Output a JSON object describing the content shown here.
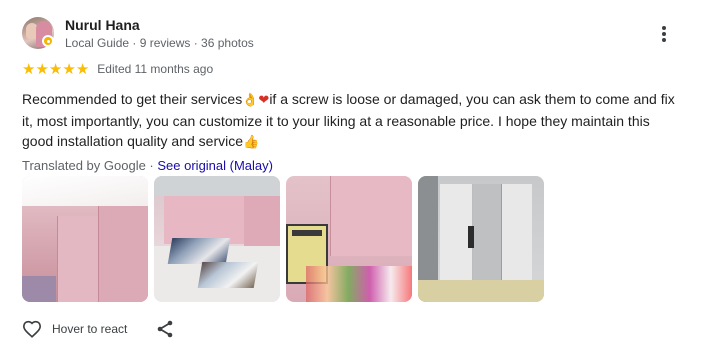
{
  "reviewer": {
    "name": "Nurul Hana",
    "meta": "Local Guide · 9 reviews · 36 photos"
  },
  "rating": {
    "stars": 5,
    "star_glyphs": [
      "★",
      "★",
      "★",
      "★",
      "★"
    ],
    "edited": "Edited 11 months ago"
  },
  "review": {
    "part1": "Recommended to get their services",
    "emoji_ok": "👌",
    "emoji_heart": "❤",
    "part2": "if a screw is loose or damaged, you can ask them to come and fix it, most importantly, you can customize it to your liking at a reasonable price. I hope they maintain this good installation quality and service",
    "emoji_thumb": "👍"
  },
  "translation": {
    "label": "Translated by Google · ",
    "link": "See original (Malay)"
  },
  "photos": [
    "pink-cabinet-photo",
    "kitchen-rug-photo",
    "oven-cabinet-photo",
    "wardrobe-photo"
  ],
  "actions": {
    "like_label": "Hover to react"
  },
  "colors": {
    "star": "#fbbc04",
    "link": "#1a0dab",
    "meta_text": "#5f6368",
    "body_text": "#1f1f1f"
  },
  "icons": {
    "more": "more-vert-icon",
    "like": "heart-outline-icon",
    "share": "share-icon"
  }
}
